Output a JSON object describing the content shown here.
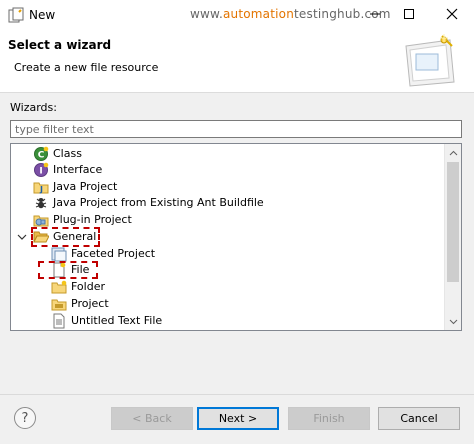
{
  "window": {
    "title": "New",
    "watermark_prefix": "www.",
    "watermark_highlight": "automation",
    "watermark_suffix": "testinghub.com"
  },
  "header": {
    "title": "Select a wizard",
    "subtitle": "Create a new file resource"
  },
  "wizards": {
    "label": "Wizards:",
    "filter_placeholder": "type filter text"
  },
  "tree": {
    "items": [
      {
        "label": "Class",
        "icon": "class-icon"
      },
      {
        "label": "Interface",
        "icon": "interface-icon"
      },
      {
        "label": "Java Project",
        "icon": "java-project-icon"
      },
      {
        "label": "Java Project from Existing Ant Buildfile",
        "icon": "ant-buildfile-icon"
      },
      {
        "label": "Plug-in Project",
        "icon": "plugin-project-icon"
      },
      {
        "label": "General",
        "icon": "folder-open-icon",
        "expanded": true
      },
      {
        "label": "Faceted Project",
        "icon": "faceted-project-icon"
      },
      {
        "label": "File",
        "icon": "file-icon",
        "selected": true
      },
      {
        "label": "Folder",
        "icon": "folder-icon"
      },
      {
        "label": "Project",
        "icon": "project-icon"
      },
      {
        "label": "Untitled Text File",
        "icon": "text-file-icon"
      }
    ]
  },
  "buttons": {
    "back": "< Back",
    "next": "Next >",
    "finish": "Finish",
    "cancel": "Cancel",
    "help": "?"
  },
  "colors": {
    "highlight_box": "#c00000",
    "watermark_accent": "#e37400"
  }
}
